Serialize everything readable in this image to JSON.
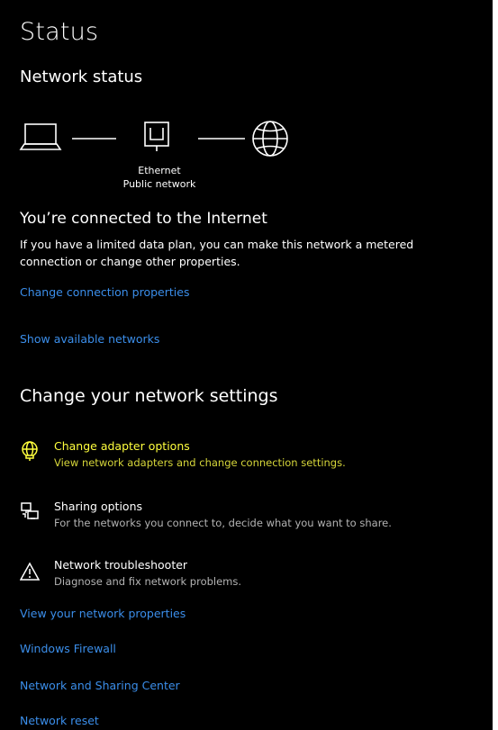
{
  "page": {
    "title": "Status"
  },
  "network_status": {
    "heading": "Network status",
    "connection_type": "Ethernet",
    "network_profile": "Public network"
  },
  "connection": {
    "title": "You’re connected to the Internet",
    "description": "If you have a limited data plan, you can make this network a metered connection or change other properties.",
    "change_properties_link": "Change connection properties",
    "show_networks_link": "Show available networks"
  },
  "change_settings": {
    "heading": "Change your network settings",
    "options": [
      {
        "title": "Change adapter options",
        "description": "View network adapters and change connection settings.",
        "icon": "adapter-globe-icon",
        "highlighted": true
      },
      {
        "title": "Sharing options",
        "description": "For the networks you connect to, decide what you want to share.",
        "icon": "sharing-icon",
        "highlighted": false
      },
      {
        "title": "Network troubleshooter",
        "description": "Diagnose and fix network problems.",
        "icon": "warning-triangle-icon",
        "highlighted": false
      }
    ]
  },
  "links": {
    "view_properties": "View your network properties",
    "firewall": "Windows Firewall",
    "sharing_center": "Network and Sharing Center",
    "reset": "Network reset"
  },
  "colors": {
    "background": "#000000",
    "text": "#ffffff",
    "link": "#3b8eea",
    "highlight": "#ffff3d",
    "secondary_text": "#b3b3b3"
  }
}
